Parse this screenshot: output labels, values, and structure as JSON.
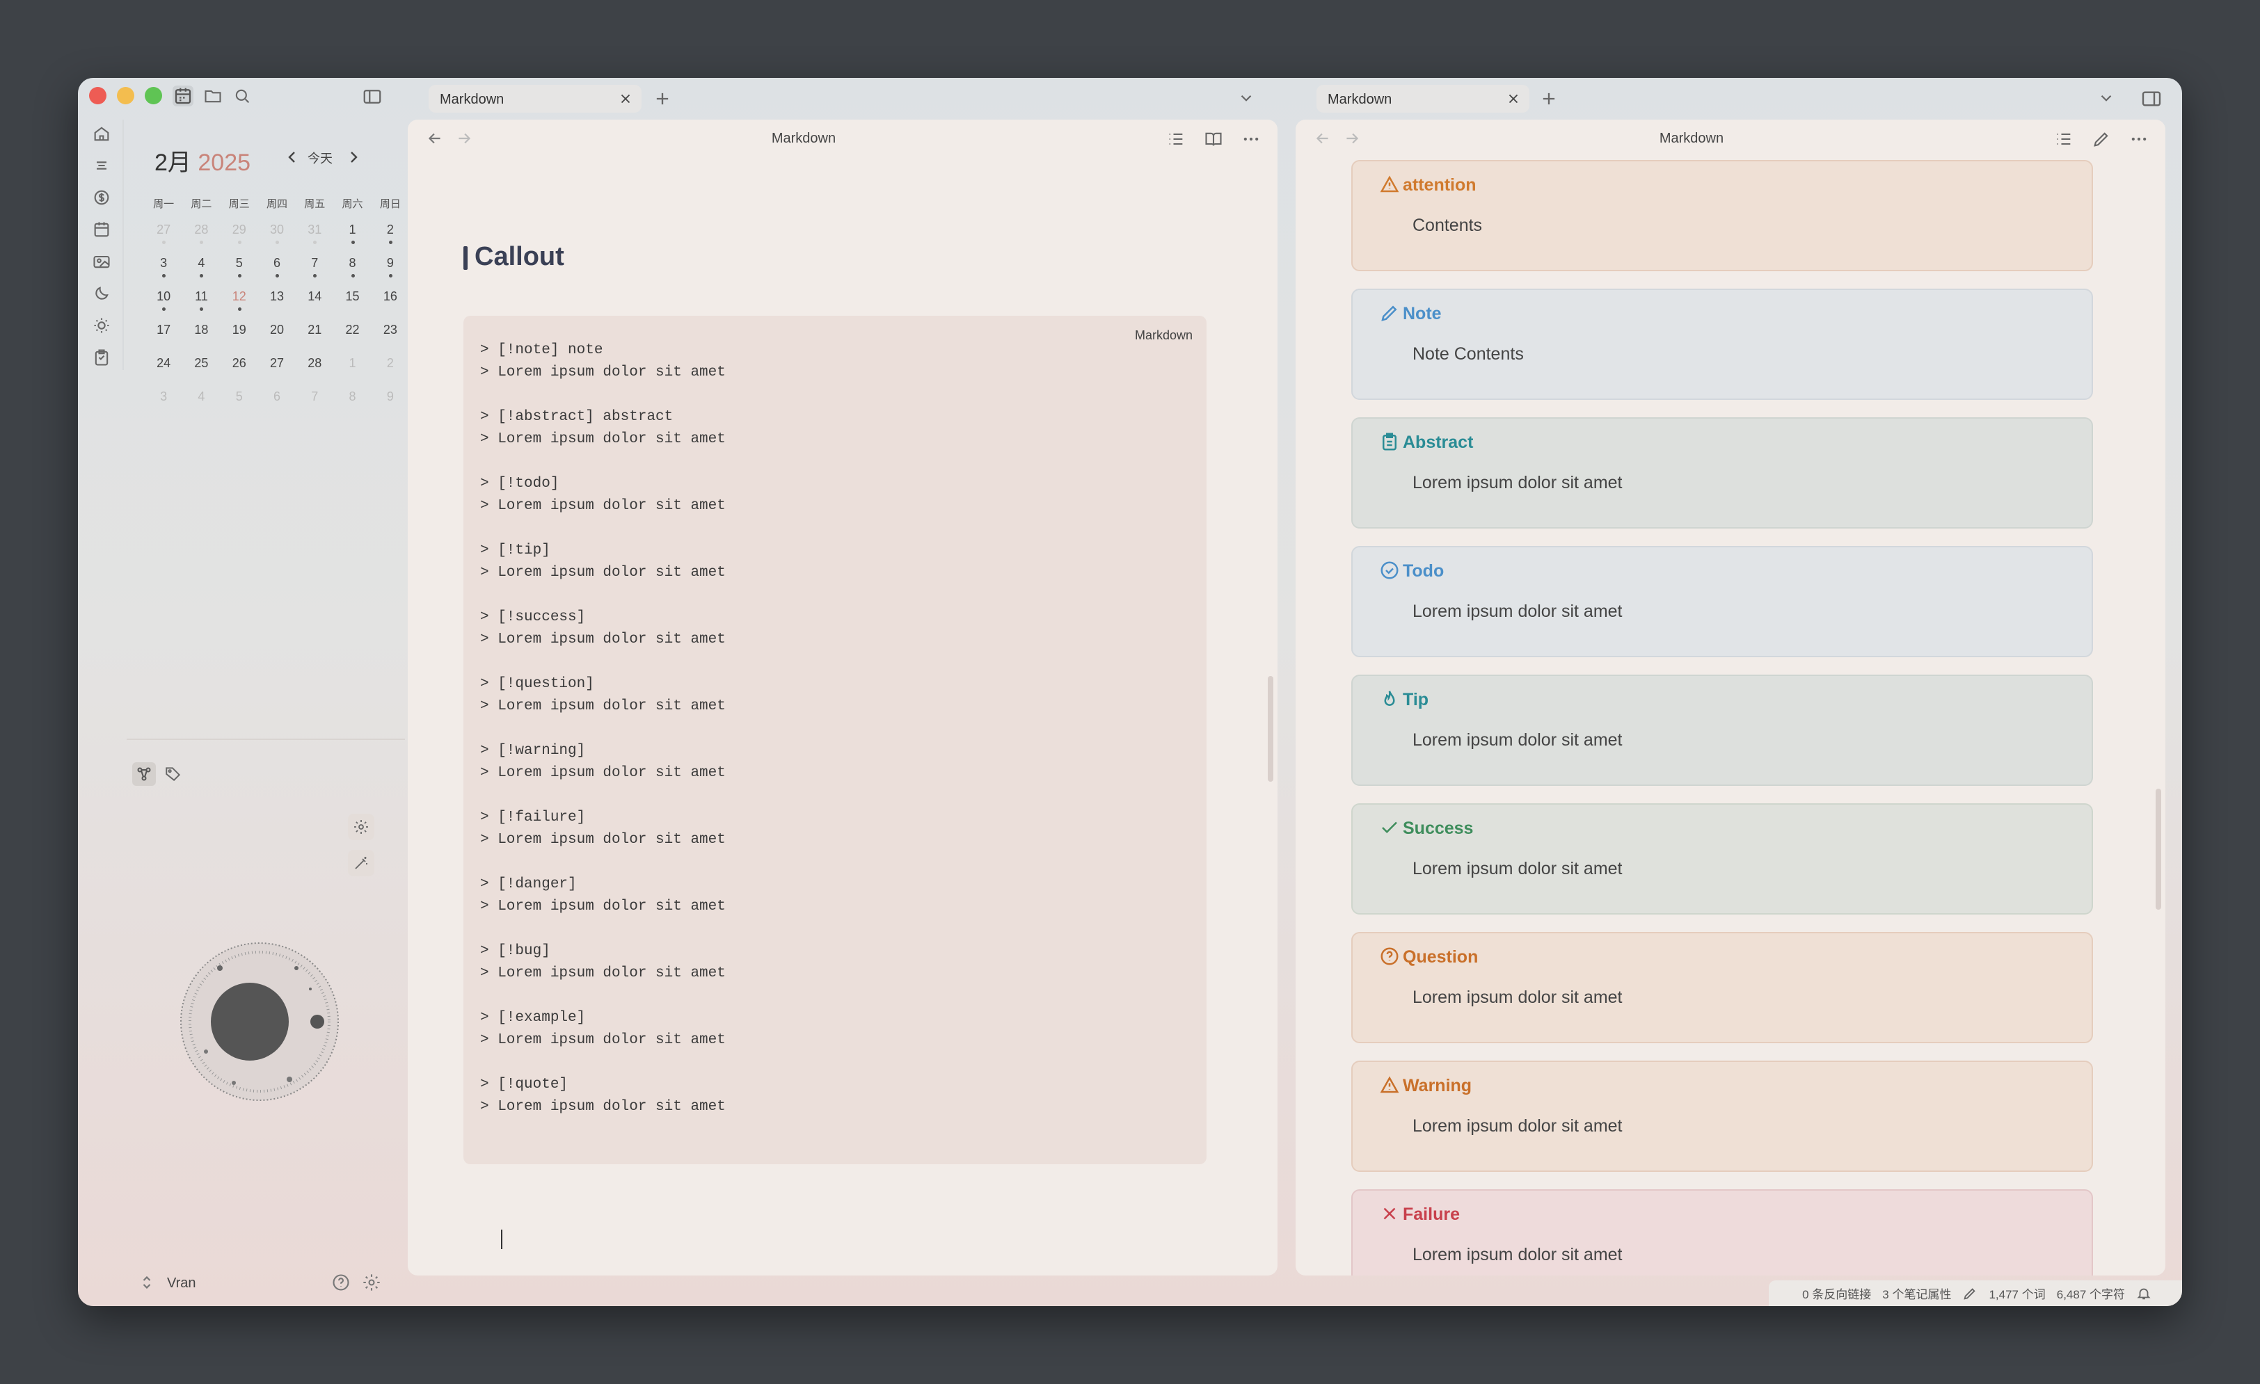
{
  "window": {
    "traffic_lights": [
      "#ee5c54",
      "#f3bd4f",
      "#5fc454"
    ]
  },
  "left_ribbon": {
    "icons": [
      "home-icon",
      "outline-icon",
      "dollar-icon",
      "calendar-icon",
      "image-icon",
      "moon-icon",
      "sun-icon",
      "clipboard-icon"
    ]
  },
  "calendar": {
    "month": "2月",
    "year": "2025",
    "today_label": "今天",
    "weekdays": [
      "周一",
      "周二",
      "周三",
      "周四",
      "周五",
      "周六",
      "周日"
    ],
    "weeks": [
      [
        {
          "d": "27",
          "o": true,
          "dot": true
        },
        {
          "d": "28",
          "o": true,
          "dot": true
        },
        {
          "d": "29",
          "o": true,
          "dot": true
        },
        {
          "d": "30",
          "o": true,
          "dot": true
        },
        {
          "d": "31",
          "o": true,
          "dot": true
        },
        {
          "d": "1",
          "dot": true
        },
        {
          "d": "2",
          "dot": true
        }
      ],
      [
        {
          "d": "3",
          "dot": true
        },
        {
          "d": "4",
          "dot": true
        },
        {
          "d": "5",
          "dot": true
        },
        {
          "d": "6",
          "dot": true
        },
        {
          "d": "7",
          "dot": true
        },
        {
          "d": "8",
          "dot": true
        },
        {
          "d": "9",
          "dot": true
        }
      ],
      [
        {
          "d": "10",
          "dot": true
        },
        {
          "d": "11",
          "dot": true
        },
        {
          "d": "12",
          "today": true,
          "dot": true
        },
        {
          "d": "13"
        },
        {
          "d": "14"
        },
        {
          "d": "15"
        },
        {
          "d": "16"
        }
      ],
      [
        {
          "d": "17"
        },
        {
          "d": "18"
        },
        {
          "d": "19"
        },
        {
          "d": "20"
        },
        {
          "d": "21"
        },
        {
          "d": "22"
        },
        {
          "d": "23"
        }
      ],
      [
        {
          "d": "24"
        },
        {
          "d": "25"
        },
        {
          "d": "26"
        },
        {
          "d": "27"
        },
        {
          "d": "28"
        },
        {
          "d": "1",
          "o": true
        },
        {
          "d": "2",
          "o": true
        }
      ],
      [
        {
          "d": "3",
          "o": true
        },
        {
          "d": "4",
          "o": true
        },
        {
          "d": "5",
          "o": true
        },
        {
          "d": "6",
          "o": true
        },
        {
          "d": "7",
          "o": true
        },
        {
          "d": "8",
          "o": true
        },
        {
          "d": "9",
          "o": true
        }
      ]
    ]
  },
  "vault": {
    "name": "Vran"
  },
  "left_pane": {
    "tab_title": "Markdown",
    "view_title": "Markdown",
    "heading": "Callout",
    "code_lang": "Markdown",
    "code": "> [!note] note\n> Lorem ipsum dolor sit amet\n\n> [!abstract] abstract\n> Lorem ipsum dolor sit amet\n\n> [!todo]\n> Lorem ipsum dolor sit amet\n\n> [!tip]\n> Lorem ipsum dolor sit amet\n\n> [!success]\n> Lorem ipsum dolor sit amet\n\n> [!question]\n> Lorem ipsum dolor sit amet\n\n> [!warning]\n> Lorem ipsum dolor sit amet\n\n> [!failure]\n> Lorem ipsum dolor sit amet\n\n> [!danger]\n> Lorem ipsum dolor sit amet\n\n> [!bug]\n> Lorem ipsum dolor sit amet\n\n> [!example]\n> Lorem ipsum dolor sit amet\n\n> [!quote]\n> Lorem ipsum dolor sit amet"
  },
  "right_pane": {
    "tab_title": "Markdown",
    "view_title": "Markdown",
    "callouts": [
      {
        "title": "attention",
        "body": "Contents",
        "color": "#d07a2e",
        "bg": "#efe0d5",
        "border": "#e5cdbd",
        "icon": "alert-triangle-icon"
      },
      {
        "title": "Note",
        "body": "Note Contents",
        "color": "#4b8fc9",
        "bg": "#e1e4e7",
        "border": "#d2d7dc",
        "icon": "pencil-icon"
      },
      {
        "title": "Abstract",
        "body": "Lorem ipsum dolor sit amet",
        "color": "#2a8c95",
        "bg": "#dde0dd",
        "border": "#cfd5d1",
        "icon": "clipboard-list-icon"
      },
      {
        "title": "Todo",
        "body": "Lorem ipsum dolor sit amet",
        "color": "#4b8fc9",
        "bg": "#e1e4e7",
        "border": "#d2d7dc",
        "icon": "check-circle-icon"
      },
      {
        "title": "Tip",
        "body": "Lorem ipsum dolor sit amet",
        "color": "#2a8c95",
        "bg": "#dde0dd",
        "border": "#cfd5d1",
        "icon": "flame-icon"
      },
      {
        "title": "Success",
        "body": "Lorem ipsum dolor sit amet",
        "color": "#3e8d5c",
        "bg": "#dfe1dc",
        "border": "#cfd6cd",
        "icon": "check-icon"
      },
      {
        "title": "Question",
        "body": "Lorem ipsum dolor sit amet",
        "color": "#c9702a",
        "bg": "#efe0d5",
        "border": "#e5cdbd",
        "icon": "help-circle-icon"
      },
      {
        "title": "Warning",
        "body": "Lorem ipsum dolor sit amet",
        "color": "#c9702a",
        "bg": "#efe0d5",
        "border": "#e5cdbd",
        "icon": "alert-triangle-icon"
      },
      {
        "title": "Failure",
        "body": "Lorem ipsum dolor sit amet",
        "color": "#c8404c",
        "bg": "#eedbdb",
        "border": "#e3c7c8",
        "icon": "x-icon"
      }
    ]
  },
  "status_bar": {
    "backlinks": "0 条反向链接",
    "properties": "3 个笔记属性",
    "words": "1,477 个词",
    "chars": "6,487 个字符"
  }
}
